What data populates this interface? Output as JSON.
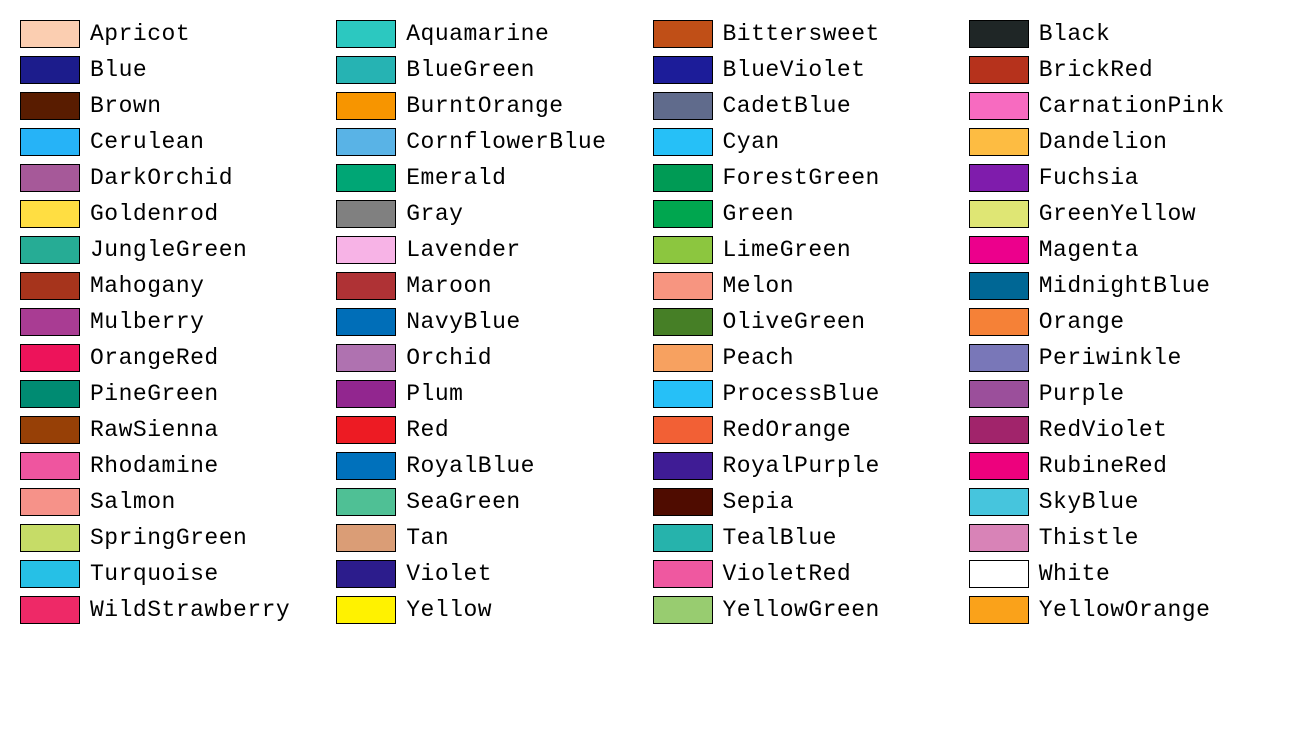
{
  "colors": [
    {
      "name": "Apricot",
      "hex": "#FBCEB1"
    },
    {
      "name": "Aquamarine",
      "hex": "#2CC8C0"
    },
    {
      "name": "Bittersweet",
      "hex": "#C04F17"
    },
    {
      "name": "Black",
      "hex": "#1F2626"
    },
    {
      "name": "Blue",
      "hex": "#1C1C8C"
    },
    {
      "name": "BlueGreen",
      "hex": "#26B3B3"
    },
    {
      "name": "BlueViolet",
      "hex": "#1C1C99"
    },
    {
      "name": "BrickRed",
      "hex": "#B6321C"
    },
    {
      "name": "Brown",
      "hex": "#591C00"
    },
    {
      "name": "BurntOrange",
      "hex": "#F79500"
    },
    {
      "name": "CadetBlue",
      "hex": "#606B8C"
    },
    {
      "name": "CarnationPink",
      "hex": "#F76BC0"
    },
    {
      "name": "Cerulean",
      "hex": "#26B3F7"
    },
    {
      "name": "CornflowerBlue",
      "hex": "#59B3E6"
    },
    {
      "name": "Cyan",
      "hex": "#26C0F7"
    },
    {
      "name": "Dandelion",
      "hex": "#FDBC42"
    },
    {
      "name": "DarkOrchid",
      "hex": "#A65999"
    },
    {
      "name": "Emerald",
      "hex": "#00A675"
    },
    {
      "name": "ForestGreen",
      "hex": "#009B55"
    },
    {
      "name": "Fuchsia",
      "hex": "#7F1CAC"
    },
    {
      "name": "Goldenrod",
      "hex": "#FFDE42"
    },
    {
      "name": "Gray",
      "hex": "#808080"
    },
    {
      "name": "Green",
      "hex": "#00A64F"
    },
    {
      "name": "GreenYellow",
      "hex": "#DFE674"
    },
    {
      "name": "JungleGreen",
      "hex": "#26AC95"
    },
    {
      "name": "Lavender",
      "hex": "#F7B3E6"
    },
    {
      "name": "LimeGreen",
      "hex": "#8CC63F"
    },
    {
      "name": "Magenta",
      "hex": "#EC008C"
    },
    {
      "name": "Mahogany",
      "hex": "#A6341C"
    },
    {
      "name": "Maroon",
      "hex": "#AF3235"
    },
    {
      "name": "Melon",
      "hex": "#F79580"
    },
    {
      "name": "MidnightBlue",
      "hex": "#006795"
    },
    {
      "name": "Mulberry",
      "hex": "#A93C93"
    },
    {
      "name": "NavyBlue",
      "hex": "#006EB8"
    },
    {
      "name": "OliveGreen",
      "hex": "#467F26"
    },
    {
      "name": "Orange",
      "hex": "#F58137"
    },
    {
      "name": "OrangeRed",
      "hex": "#ED135A"
    },
    {
      "name": "Orchid",
      "hex": "#AF72B0"
    },
    {
      "name": "Peach",
      "hex": "#F7A160"
    },
    {
      "name": "Periwinkle",
      "hex": "#7977B8"
    },
    {
      "name": "PineGreen",
      "hex": "#008B72"
    },
    {
      "name": "Plum",
      "hex": "#92268F"
    },
    {
      "name": "ProcessBlue",
      "hex": "#26C0F7"
    },
    {
      "name": "Purple",
      "hex": "#9B4F9B"
    },
    {
      "name": "RawSienna",
      "hex": "#974006"
    },
    {
      "name": "Red",
      "hex": "#ED1B23"
    },
    {
      "name": "RedOrange",
      "hex": "#F26035"
    },
    {
      "name": "RedViolet",
      "hex": "#A1246B"
    },
    {
      "name": "Rhodamine",
      "hex": "#EF559F"
    },
    {
      "name": "RoyalBlue",
      "hex": "#0071BC"
    },
    {
      "name": "RoyalPurple",
      "hex": "#3F1C95"
    },
    {
      "name": "RubineRed",
      "hex": "#ED017D"
    },
    {
      "name": "Salmon",
      "hex": "#F69289"
    },
    {
      "name": "SeaGreen",
      "hex": "#4FC095"
    },
    {
      "name": "Sepia",
      "hex": "#4F0C00"
    },
    {
      "name": "SkyBlue",
      "hex": "#46C5DD"
    },
    {
      "name": "SpringGreen",
      "hex": "#C6DC67"
    },
    {
      "name": "Tan",
      "hex": "#DA9D76"
    },
    {
      "name": "TealBlue",
      "hex": "#26B3AC"
    },
    {
      "name": "Thistle",
      "hex": "#D883B7"
    },
    {
      "name": "Turquoise",
      "hex": "#26C0E6"
    },
    {
      "name": "Violet",
      "hex": "#2C1C8C"
    },
    {
      "name": "VioletRed",
      "hex": "#EF58A0"
    },
    {
      "name": "White",
      "hex": "#FFFFFF"
    },
    {
      "name": "WildStrawberry",
      "hex": "#EE2967"
    },
    {
      "name": "Yellow",
      "hex": "#FFF200"
    },
    {
      "name": "YellowGreen",
      "hex": "#98CC70"
    },
    {
      "name": "YellowOrange",
      "hex": "#FAA21A"
    }
  ]
}
